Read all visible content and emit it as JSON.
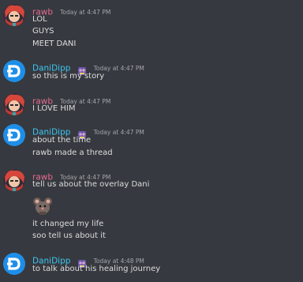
{
  "users": {
    "rawb": "rawb",
    "dani": "DaniDipp"
  },
  "messages": [
    {
      "author": "rawb",
      "timestamp": "Today at 4:47 PM",
      "lines": [
        "LOL",
        "GUYS",
        "MEET DANI"
      ]
    },
    {
      "author": "DaniDipp",
      "timestamp": "Today at 4:47 PM",
      "lines": [
        "so this is my story"
      ]
    },
    {
      "author": "rawb",
      "timestamp": "Today at 4:47 PM",
      "lines": [
        "I LOVE HIM"
      ]
    },
    {
      "author": "DaniDipp",
      "timestamp": "Today at 4:47 PM",
      "lines": [
        "about the time",
        "rawb made a thread"
      ]
    },
    {
      "author": "rawb",
      "timestamp": "Today at 4:47 PM",
      "lines": [
        "tell us about the overlay Dani",
        "it changed my life",
        "soo tell us about it"
      ],
      "sticker": "mouse-sticker"
    },
    {
      "author": "DaniDipp",
      "timestamp": "Today at 4:48 PM",
      "lines": [
        "to talk about his healing journey"
      ]
    }
  ],
  "colors": {
    "background": "#36393f",
    "rawb_name": "#e56b8f",
    "dani_name": "#3ec6f0",
    "text": "#dcddde",
    "timestamp": "#a3a6aa"
  }
}
